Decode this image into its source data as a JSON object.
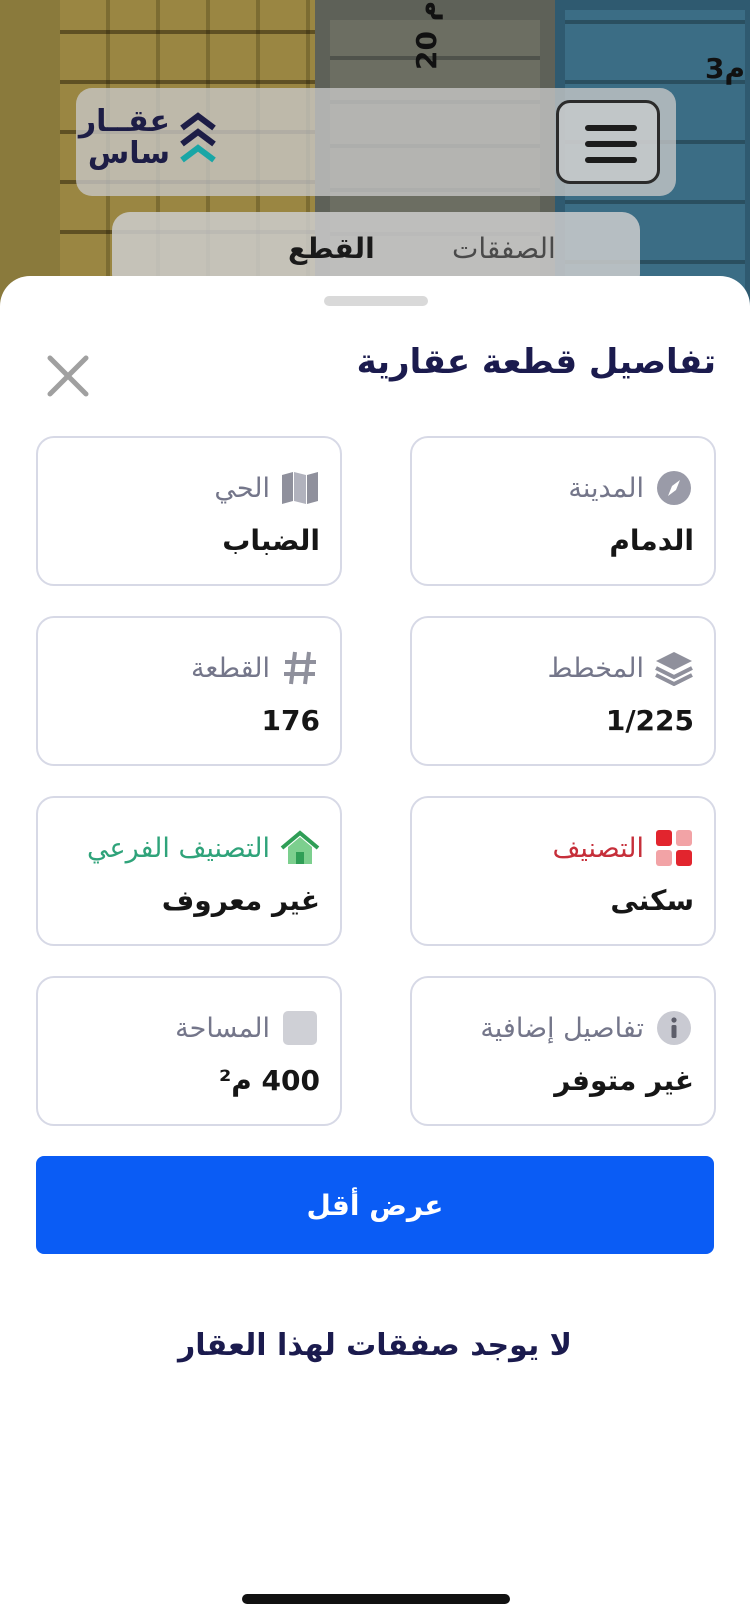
{
  "map": {
    "labels": [
      "20 م",
      "3م"
    ]
  },
  "header": {
    "logo_text_line1": "عقــار",
    "logo_text_line2": "ساس"
  },
  "tabs": [
    {
      "label": "القطع",
      "active": true
    },
    {
      "label": "الصفقات",
      "active": false
    }
  ],
  "sheet": {
    "title": "تفاصيل قطعة عقارية",
    "fields": {
      "city": {
        "label": "المدينة",
        "value": "الدمام",
        "icon": "compass-icon"
      },
      "district": {
        "label": "الحي",
        "value": "الضباب",
        "icon": "map-icon"
      },
      "plan": {
        "label": "المخطط",
        "value": "1/225",
        "icon": "layers-icon"
      },
      "plot": {
        "label": "القطعة",
        "value": "176",
        "icon": "hash-icon"
      },
      "classification": {
        "label": "التصنيف",
        "value": "سكنى",
        "icon": "grid-icon",
        "label_color": "#c62f3a"
      },
      "sub_classification": {
        "label": "التصنيف الفرعي",
        "value": "غير معروف",
        "icon": "house-icon",
        "label_color": "#2fa37a"
      },
      "extra_details": {
        "label": "تفاصيل إضافية",
        "value": "غير متوفر",
        "icon": "info-icon"
      },
      "area": {
        "label": "المساحة",
        "value": "400 م²",
        "icon": "square-icon"
      }
    },
    "show_less_label": "عرض أقل",
    "no_deals_text": "لا يوجد صفقات لهذا العقار"
  }
}
